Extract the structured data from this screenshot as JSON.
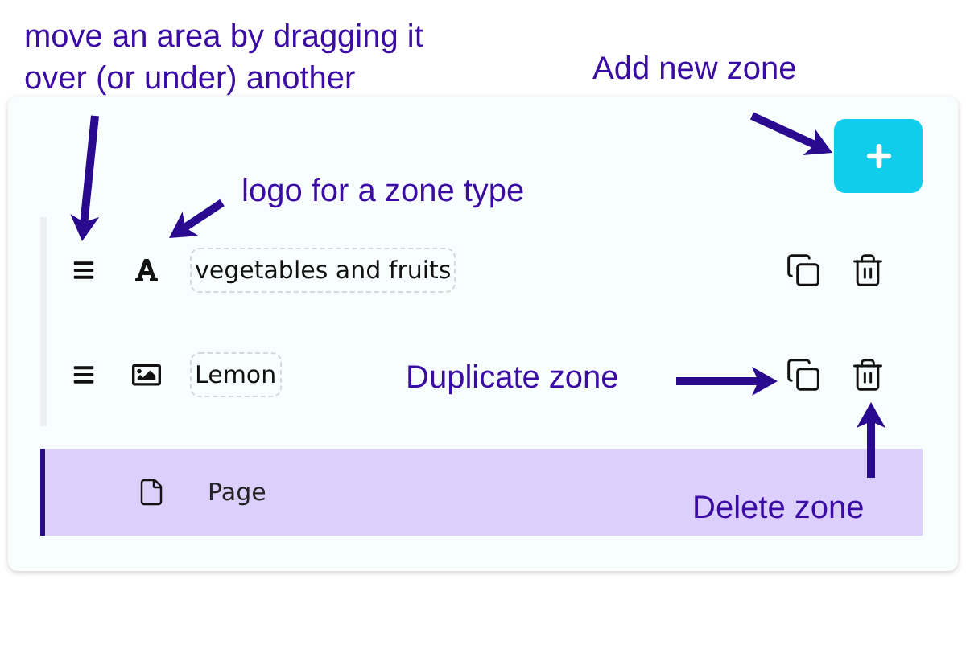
{
  "annotations": [
    {
      "text": "move an area by dragging it over (or under) another"
    },
    {
      "text": "Add new zone"
    },
    {
      "text": "logo for a zone type"
    },
    {
      "text": "Duplicate zone"
    },
    {
      "text": "Delete zone"
    }
  ],
  "zones": [
    {
      "kind": "text",
      "value": "vegetables and fruits",
      "selected": false
    },
    {
      "kind": "image",
      "value": "Lemon",
      "selected": false
    }
  ],
  "page": {
    "label": "Page",
    "selected": true
  }
}
